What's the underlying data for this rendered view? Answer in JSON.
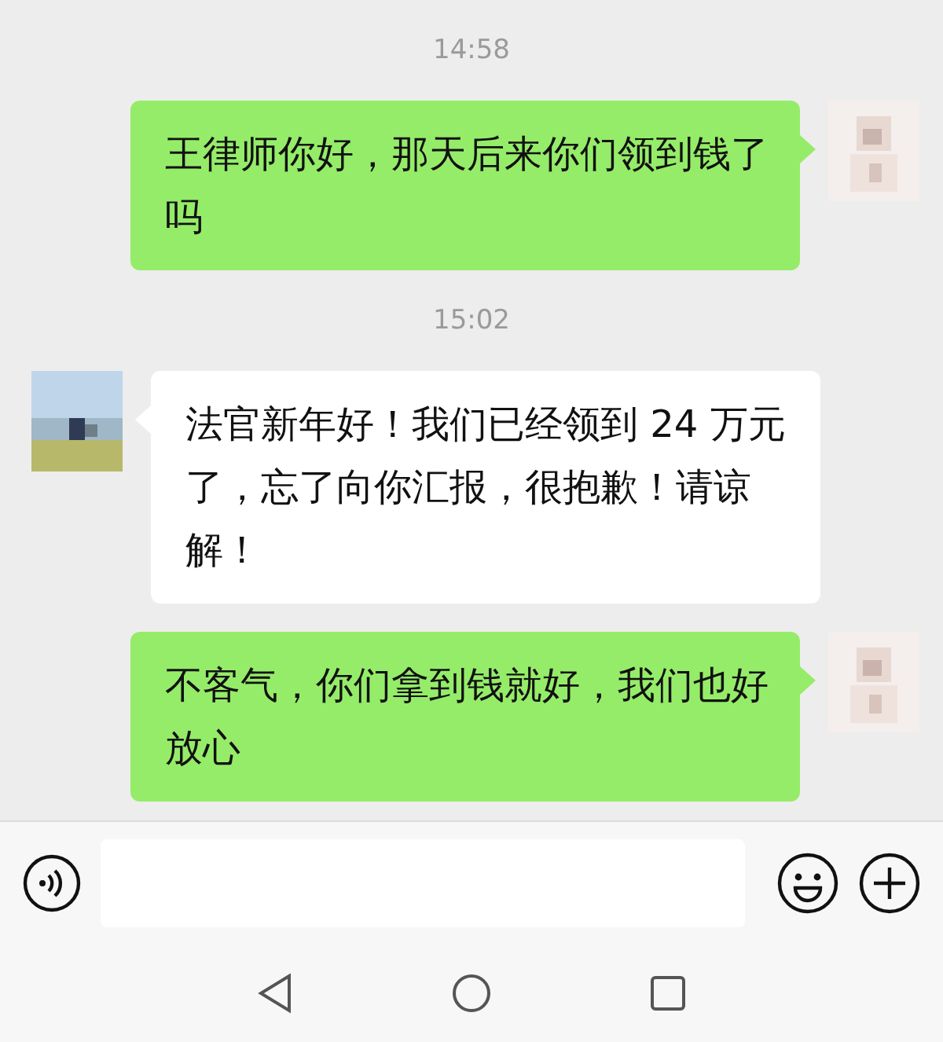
{
  "messages": [
    {
      "kind": "time",
      "text": "14:58"
    },
    {
      "kind": "message",
      "outgoing": true,
      "text": "王律师你好，那天后来你们领到钱了吗"
    },
    {
      "kind": "time",
      "text": "15:02"
    },
    {
      "kind": "message",
      "outgoing": false,
      "text": "法官新年好！我们已经领到 24 万元了，忘了向你汇报，很抱歉！请谅解！"
    },
    {
      "kind": "message",
      "outgoing": true,
      "text": "不客气，你们拿到钱就好，我们也好放心"
    }
  ]
}
